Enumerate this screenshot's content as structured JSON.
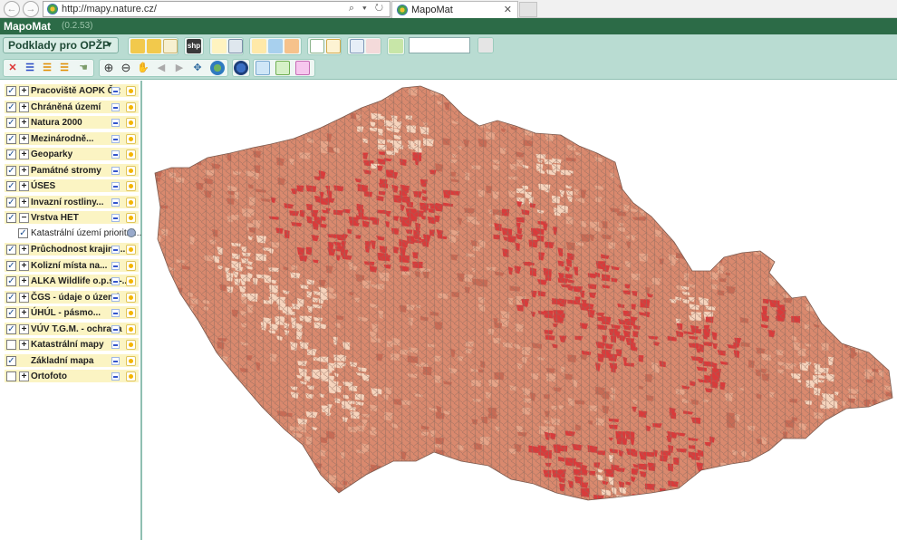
{
  "browser": {
    "url": "http://mapy.nature.cz/",
    "tab_title": "MapoMat",
    "tab_close": "✕",
    "back_glyph": "←",
    "forward_glyph": "→",
    "address_icons": "⌕ ▾ ↻"
  },
  "app": {
    "title": "MapoMat",
    "version": "(0.2.53)"
  },
  "toolbar": {
    "project": "Podklady pro OPŽP",
    "project_caret": "▼",
    "shp_label": "shp",
    "search_value": ""
  },
  "layers": [
    {
      "label": "Pracoviště AOPK ČR",
      "checked": "✓",
      "expand": "+"
    },
    {
      "label": "Chráněná území",
      "checked": "✓",
      "expand": "+"
    },
    {
      "label": "Natura 2000",
      "checked": "✓",
      "expand": "+"
    },
    {
      "label": "Mezinárodně...",
      "checked": "✓",
      "expand": "+"
    },
    {
      "label": "Geoparky",
      "checked": "✓",
      "expand": "+"
    },
    {
      "label": "Památné stromy",
      "checked": "✓",
      "expand": "+"
    },
    {
      "label": "ÚSES",
      "checked": "✓",
      "expand": "+"
    },
    {
      "label": "Invazní rostliny...",
      "checked": "✓",
      "expand": "+"
    },
    {
      "label": "Vrstva HET",
      "checked": "✓",
      "expand": "−"
    },
    {
      "label": "Průchodnost krajiny...",
      "checked": "✓",
      "expand": "+"
    },
    {
      "label": "Kolizní místa na...",
      "checked": "✓",
      "expand": "+"
    },
    {
      "label": "ALKA Wildlife o.p.s. -...",
      "checked": "✓",
      "expand": "+"
    },
    {
      "label": "ČGS - údaje o území",
      "checked": "✓",
      "expand": "+"
    },
    {
      "label": "ÚHÚL - pásmo...",
      "checked": "✓",
      "expand": "+"
    },
    {
      "label": "VÚV T.G.M. - ochrana",
      "checked": "✓",
      "expand": "+"
    },
    {
      "label": "Katastrální mapy",
      "checked": "",
      "expand": "+"
    },
    {
      "label": "Základní mapa",
      "checked": "✓",
      "expand": ""
    },
    {
      "label": "Ortofoto",
      "checked": "",
      "expand": "+"
    }
  ],
  "sublayer": {
    "label": "Katastrální území prioritní...",
    "checked": "✓"
  },
  "colors": {
    "header": "#2c6b47",
    "toolbar": "#b9dcd2",
    "layer_bg": "#fbf4c3",
    "map_low": "#f6d4bd",
    "map_mid": "#d9896e",
    "map_high": "#d93b3b"
  }
}
